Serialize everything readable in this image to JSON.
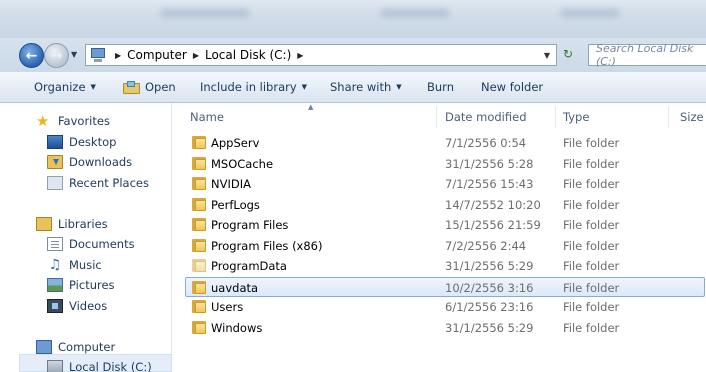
{
  "address": {
    "crumbs": [
      "Computer",
      "Local Disk (C:)"
    ],
    "search_placeholder": "Search Local Disk (C:)"
  },
  "toolbar": {
    "organize": "Organize",
    "open": "Open",
    "include_in_library": "Include in library",
    "share_with": "Share with",
    "burn": "Burn",
    "new_folder": "New folder"
  },
  "nav": {
    "favorites": "Favorites",
    "desktop": "Desktop",
    "downloads": "Downloads",
    "recent_places": "Recent Places",
    "libraries": "Libraries",
    "documents": "Documents",
    "music": "Music",
    "pictures": "Pictures",
    "videos": "Videos",
    "computer": "Computer",
    "local_disk": "Local Disk (C:)"
  },
  "columns": {
    "name": "Name",
    "date_modified": "Date modified",
    "type": "Type",
    "size": "Size"
  },
  "files": [
    {
      "name": "AppServ",
      "date": "7/1/2556 0:54",
      "type": "File folder"
    },
    {
      "name": "MSOCache",
      "date": "31/1/2556 5:28",
      "type": "File folder"
    },
    {
      "name": "NVIDIA",
      "date": "7/1/2556 15:43",
      "type": "File folder"
    },
    {
      "name": "PerfLogs",
      "date": "14/7/2552 10:20",
      "type": "File folder"
    },
    {
      "name": "Program Files",
      "date": "15/1/2556 21:59",
      "type": "File folder"
    },
    {
      "name": "Program Files (x86)",
      "date": "7/2/2556 2:44",
      "type": "File folder"
    },
    {
      "name": "ProgramData",
      "date": "31/1/2556 5:29",
      "type": "File folder"
    },
    {
      "name": "uavdata",
      "date": "10/2/2556 3:16",
      "type": "File folder"
    },
    {
      "name": "Users",
      "date": "6/1/2556 23:16",
      "type": "File folder"
    },
    {
      "name": "Windows",
      "date": "31/1/2556 5:29",
      "type": "File folder"
    }
  ]
}
